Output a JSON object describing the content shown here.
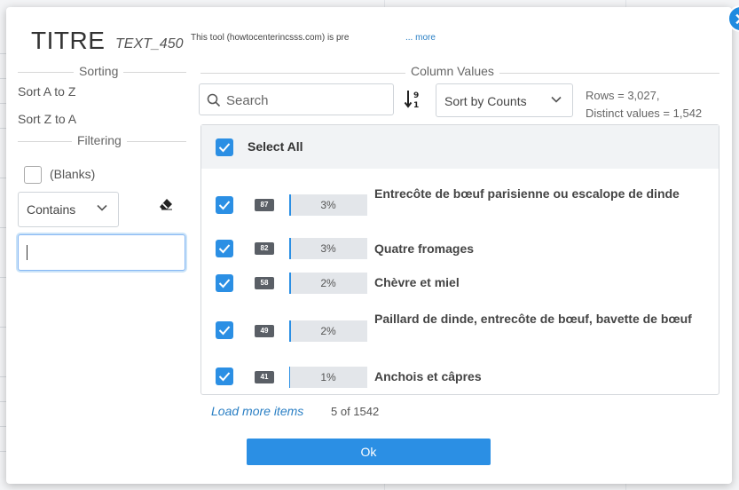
{
  "dialog": {
    "close_icon": "close-icon",
    "title": "TITRE",
    "column_id": "TEXT_450",
    "description": "This tool (howtocenterincsss.com) is pre",
    "more_link": "... more"
  },
  "sorting": {
    "header": "Sorting",
    "sort_asc": "Sort A to Z",
    "sort_desc": "Sort Z to A"
  },
  "filtering": {
    "header": "Filtering",
    "blanks_label": "(Blanks)",
    "condition_selected": "Contains",
    "clear_icon": "eraser-icon",
    "value": ""
  },
  "column_values": {
    "header": "Column Values",
    "search_placeholder": "Search",
    "sort_toggle_icon": "sort-numeric-desc-icon",
    "sort_selected": "Sort by Counts",
    "rows_info": "Rows = 3,027,",
    "distinct_info": "Distinct values = 1,542",
    "select_all_label": "Select All",
    "items": [
      {
        "count": "87",
        "percent_label": "3%",
        "percent": 0.03,
        "label": "Entrecôte de bœuf parisienne ou escalope de dinde",
        "checked": true
      },
      {
        "count": "82",
        "percent_label": "3%",
        "percent": 0.03,
        "label": "Quatre fromages",
        "checked": true
      },
      {
        "count": "58",
        "percent_label": "2%",
        "percent": 0.02,
        "label": "Chèvre et miel",
        "checked": true
      },
      {
        "count": "49",
        "percent_label": "2%",
        "percent": 0.02,
        "label": "Paillard de dinde, entrecôte de bœuf, bavette de bœuf",
        "checked": true
      },
      {
        "count": "41",
        "percent_label": "1%",
        "percent": 0.01,
        "label": "Anchois et câpres",
        "checked": true
      }
    ],
    "load_more": "Load more items",
    "page_count": "5 of 1542"
  },
  "footer": {
    "ok_label": "Ok"
  },
  "colors": {
    "accent": "#2b8fe4",
    "badge": "#5a5f66",
    "link": "#2a7fc4"
  }
}
